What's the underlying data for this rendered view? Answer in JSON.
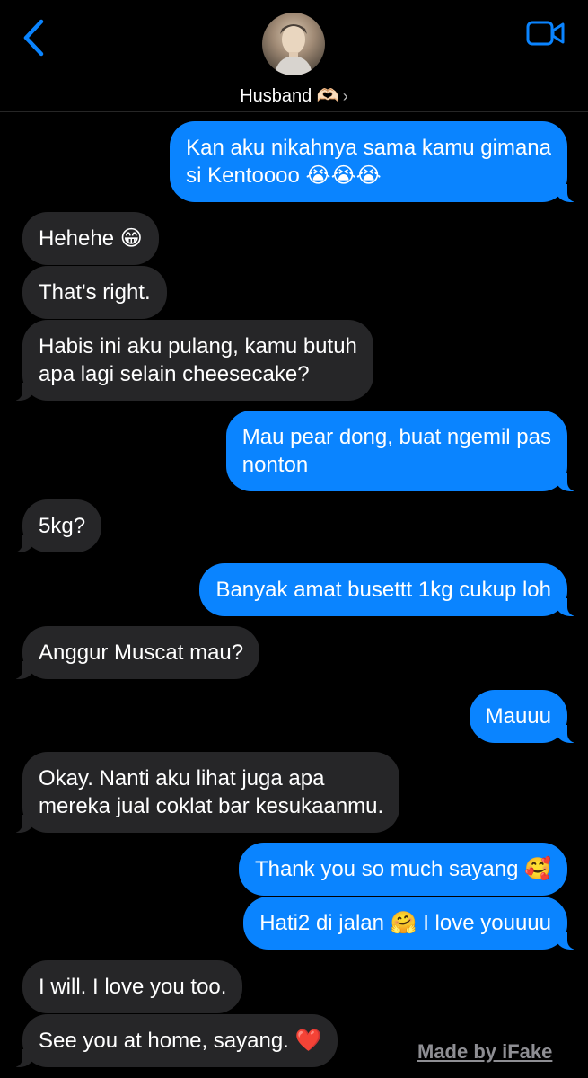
{
  "header": {
    "contact_name": "Husband 🫶🏻",
    "chevron": "›",
    "icons": {
      "back": "chevron-left-icon",
      "video": "video-camera-icon"
    },
    "accent_color": "#0a84ff"
  },
  "messages": [
    {
      "from": "me",
      "text": "Kan aku nikahnya sama kamu gimana\nsi Kentoooo 😭😭😭"
    },
    {
      "from": "them",
      "text": "Hehehe 😁"
    },
    {
      "from": "them",
      "text": "That's right."
    },
    {
      "from": "them",
      "text": "Habis ini aku pulang, kamu butuh\napa lagi selain cheesecake?"
    },
    {
      "from": "me",
      "text": "Mau pear dong, buat ngemil pas\nnonton"
    },
    {
      "from": "them",
      "text": "5kg?"
    },
    {
      "from": "me",
      "text": "Banyak amat busettt 1kg cukup loh"
    },
    {
      "from": "them",
      "text": "Anggur Muscat mau?"
    },
    {
      "from": "me",
      "text": "Mauuu"
    },
    {
      "from": "them",
      "text": "Okay. Nanti aku lihat juga apa\nmereka jual coklat bar kesukaanmu."
    },
    {
      "from": "me",
      "text": "Thank you so much sayang 🥰"
    },
    {
      "from": "me",
      "text": "Hati2 di jalan 🤗 I love youuuu"
    },
    {
      "from": "them",
      "text": "I will. I love you too."
    },
    {
      "from": "them",
      "text": "See you at home, sayang. ❤️"
    }
  ],
  "watermark": "Made by iFake",
  "colors": {
    "incoming": "#262628",
    "outgoing": "#0a84ff",
    "background": "#000000"
  }
}
